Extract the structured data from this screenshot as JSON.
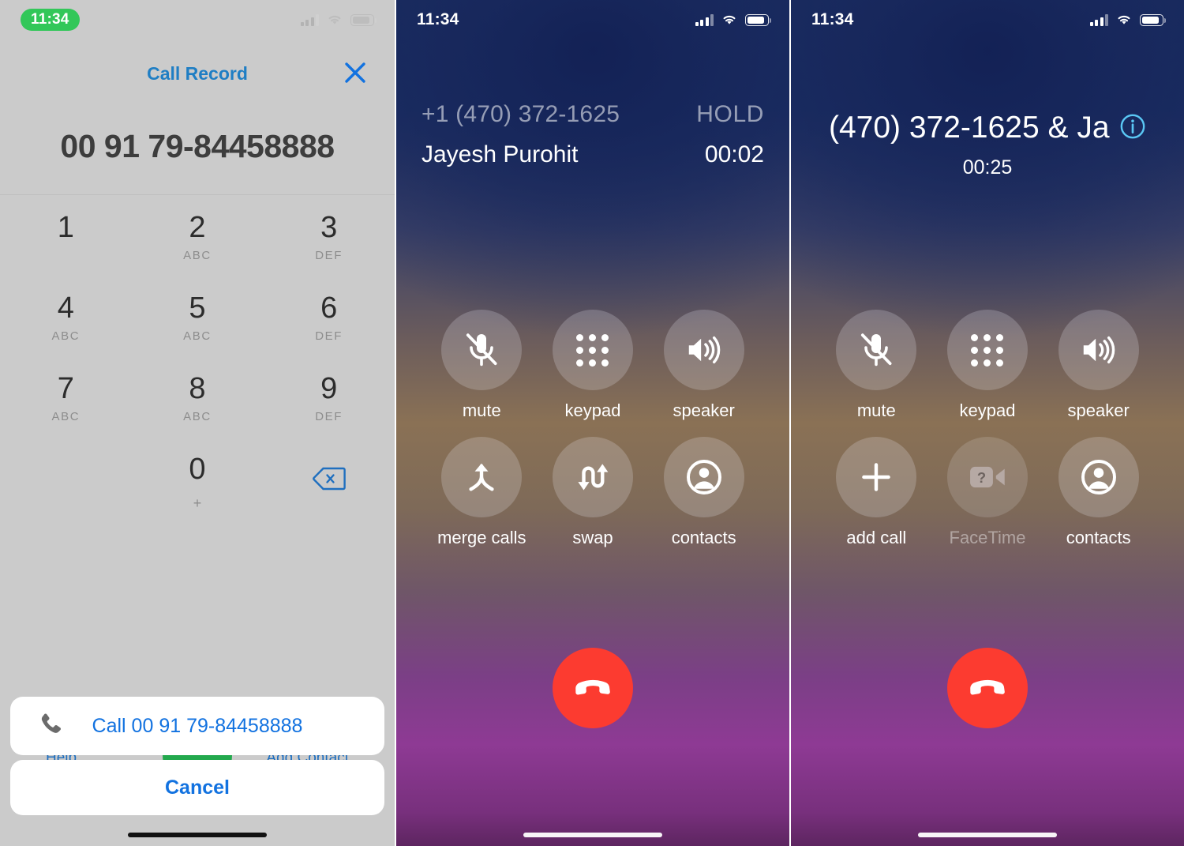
{
  "panel1": {
    "status": {
      "time": "11:34",
      "signal_icon": "cellular-bars-icon",
      "wifi_icon": "wifi-icon",
      "battery_icon": "battery-icon"
    },
    "title": "Call Record",
    "close_icon": "close-icon",
    "number": "00 91 79-84458888",
    "keypad": [
      {
        "digit": "1",
        "letters": ""
      },
      {
        "digit": "2",
        "letters": "ABC"
      },
      {
        "digit": "3",
        "letters": "DEF"
      },
      {
        "digit": "4",
        "letters": "ABC"
      },
      {
        "digit": "5",
        "letters": "ABC"
      },
      {
        "digit": "6",
        "letters": "DEF"
      },
      {
        "digit": "7",
        "letters": "ABC"
      },
      {
        "digit": "8",
        "letters": "ABC"
      },
      {
        "digit": "9",
        "letters": "DEF"
      },
      {
        "digit": "0",
        "letters": "+"
      }
    ],
    "delete_icon": "backspace-delete-icon",
    "call_button_icon": "green-call-button",
    "help_label": "Help",
    "add_contact_label": "Add Contact",
    "sheet_call_label": "Call 00 91 79-84458888",
    "sheet_call_icon": "phone-handset-icon",
    "sheet_cancel_label": "Cancel",
    "home_indicator": "home-indicator"
  },
  "panel2": {
    "status": {
      "time": "11:34",
      "signal_icon": "cellular-bars-icon",
      "wifi_icon": "wifi-icon",
      "battery_icon": "battery-icon"
    },
    "call1_number": "+1 (470) 372-1625",
    "call1_state": "HOLD",
    "call2_name": "Jayesh Purohit",
    "call2_timer": "00:02",
    "buttons": [
      {
        "label": "mute",
        "icon": "microphone-slash-icon",
        "disabled": false
      },
      {
        "label": "keypad",
        "icon": "keypad-dots-icon",
        "disabled": false
      },
      {
        "label": "speaker",
        "icon": "speaker-waves-icon",
        "disabled": false
      },
      {
        "label": "merge calls",
        "icon": "merge-arrow-icon",
        "disabled": false
      },
      {
        "label": "swap",
        "icon": "swap-arrows-icon",
        "disabled": false
      },
      {
        "label": "contacts",
        "icon": "person-circle-icon",
        "disabled": false
      }
    ],
    "end_call_icon": "end-call-handset-icon",
    "home_indicator": "home-indicator"
  },
  "panel3": {
    "status": {
      "time": "11:34",
      "signal_icon": "cellular-bars-icon",
      "wifi_icon": "wifi-icon",
      "battery_icon": "battery-icon"
    },
    "title": "(470) 372-1625 & Ja",
    "info_icon": "info-circle-icon",
    "timer": "00:25",
    "buttons": [
      {
        "label": "mute",
        "icon": "microphone-slash-icon",
        "disabled": false
      },
      {
        "label": "keypad",
        "icon": "keypad-dots-icon",
        "disabled": false
      },
      {
        "label": "speaker",
        "icon": "speaker-waves-icon",
        "disabled": false
      },
      {
        "label": "add call",
        "icon": "plus-icon",
        "disabled": false
      },
      {
        "label": "FaceTime",
        "icon": "facetime-video-icon",
        "disabled": true
      },
      {
        "label": "contacts",
        "icon": "person-circle-icon",
        "disabled": false
      }
    ],
    "end_call_icon": "end-call-handset-icon",
    "home_indicator": "home-indicator"
  },
  "colors": {
    "accent_blue": "#1272e0",
    "title_blue": "#1f7ec4",
    "call_green": "#23a94d",
    "status_pill_green": "#32c759",
    "end_call_red": "#fc3b30",
    "panel1_bg": "#cbcbcb",
    "info_blue": "#5ac8f5"
  }
}
